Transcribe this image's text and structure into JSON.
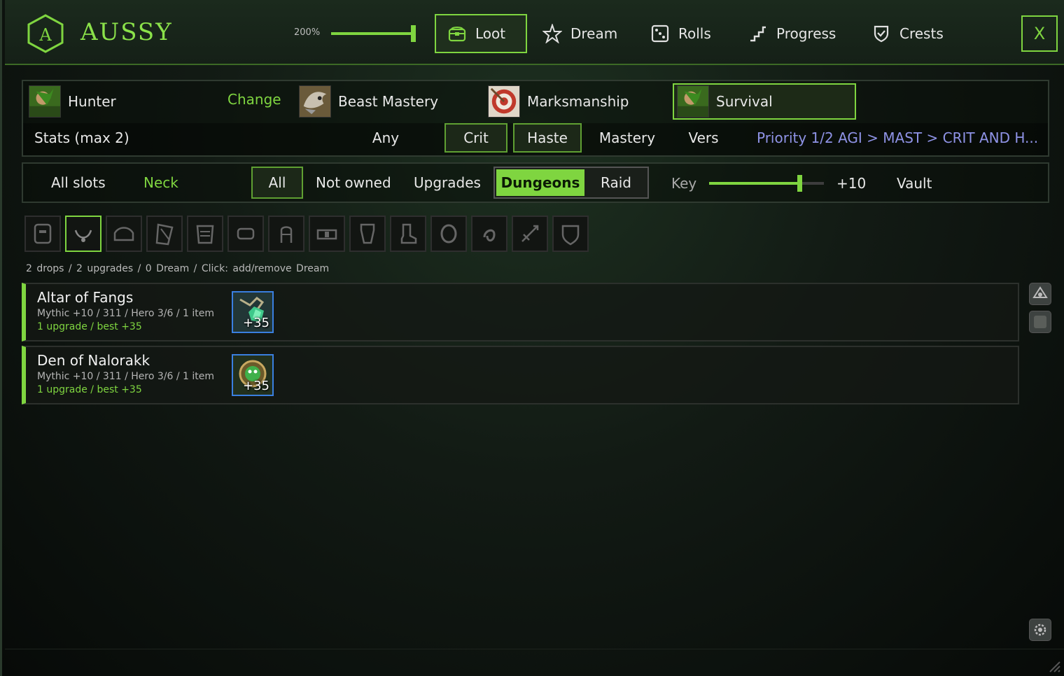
{
  "app": {
    "title": "AUSSY",
    "logo_letter": "A",
    "zoom": "200%",
    "zoom_level": 1.0
  },
  "nav": {
    "tabs": [
      {
        "label": "Loot",
        "icon": "chest-icon",
        "active": true
      },
      {
        "label": "Dream",
        "icon": "star-icon",
        "active": false
      },
      {
        "label": "Rolls",
        "icon": "dice-icon",
        "active": false
      },
      {
        "label": "Progress",
        "icon": "stairs-icon",
        "active": false
      },
      {
        "label": "Crests",
        "icon": "shield-check-icon",
        "active": false
      }
    ],
    "close_label": "X"
  },
  "spec": {
    "class_name": "Hunter",
    "change_label": "Change",
    "specs": [
      {
        "label": "Beast Mastery",
        "active": false
      },
      {
        "label": "Marksmanship",
        "active": false
      },
      {
        "label": "Survival",
        "active": true
      }
    ]
  },
  "stats": {
    "label": "Stats (max 2)",
    "options": [
      {
        "label": "Any",
        "active": false
      },
      {
        "label": "Crit",
        "active": true
      },
      {
        "label": "Haste",
        "active": true
      },
      {
        "label": "Mastery",
        "active": false
      },
      {
        "label": "Vers",
        "active": false
      }
    ],
    "priority": "Priority 1/2  AGI > MAST > CRIT AND H..."
  },
  "filters": {
    "slots_label": "All slots",
    "slot_selected": "Neck",
    "ownership": [
      {
        "label": "All",
        "active": true
      },
      {
        "label": "Not owned",
        "active": false
      },
      {
        "label": "Upgrades",
        "active": false
      }
    ],
    "source_on": "Dungeons",
    "source_off": "Raid",
    "key_label": "Key",
    "key_value": "+10",
    "key_level": 0.8,
    "vault_label": "Vault"
  },
  "slot_icons": [
    "helm-icon",
    "neck-icon",
    "shoulder-icon",
    "cloak-icon",
    "chest-armor-icon",
    "wrist-icon",
    "gloves-icon",
    "belt-icon",
    "legs-icon",
    "boots-icon",
    "ring-icon",
    "trinket-icon",
    "weapon-icon",
    "offhand-icon"
  ],
  "slot_active_index": 1,
  "summary": "2 drops  /  2 upgrades  /  0 Dream  /  Click: add/remove Dream",
  "sources": [
    {
      "name": "Altar of Fangs",
      "meta": "Mythic +10  /  311  /  Hero 3/6  /  1 item",
      "upgrade": "1 upgrade / best +35",
      "badge": "+35"
    },
    {
      "name": "Den of Nalorakk",
      "meta": "Mythic +10  /  311  /  Hero 3/6  /  1 item",
      "upgrade": "1 upgrade / best +35",
      "badge": "+35"
    }
  ],
  "colors": {
    "accent": "#7fd540",
    "priority": "#8f93e6",
    "item_border": "#3a7fe0"
  }
}
